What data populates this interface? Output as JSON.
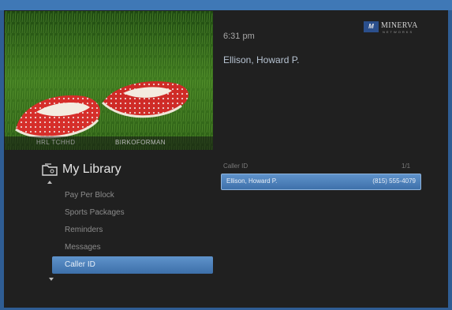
{
  "preview": {
    "channel_number": "HRL TCHHD",
    "channel_name": "BIRKOFORMAN"
  },
  "info": {
    "time": "6:31 pm",
    "brand_name": "MINERVA",
    "brand_sub": "NETWORKS",
    "brand_mark": "M",
    "selected_name": "Ellison, Howard P."
  },
  "library": {
    "title": "My Library",
    "items": [
      {
        "label": "Pay Per Block"
      },
      {
        "label": "Sports Packages"
      },
      {
        "label": "Reminders"
      },
      {
        "label": "Messages"
      },
      {
        "label": "Caller ID",
        "selected": true
      }
    ]
  },
  "caller_id": {
    "header": "Caller ID",
    "count": "1/1",
    "entries": [
      {
        "name": "Ellison, Howard P.",
        "phone": "(815) 555-4079"
      }
    ]
  },
  "colors": {
    "accent": "#3f78b6",
    "highlight": "#4f83bd",
    "background": "#202020"
  }
}
